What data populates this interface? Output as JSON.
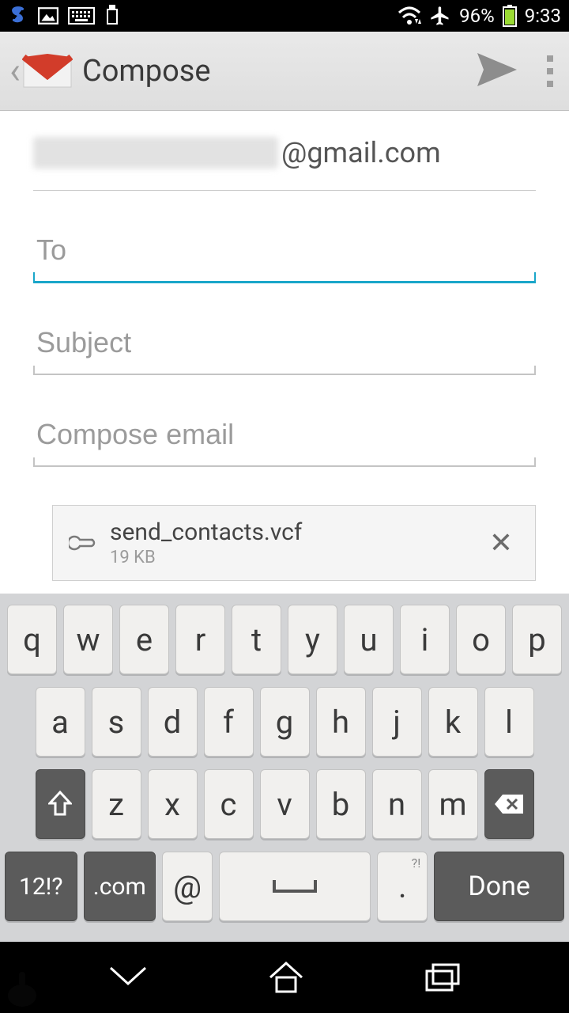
{
  "statusbar": {
    "battery_pct": "96%",
    "clock": "9:33"
  },
  "appbar": {
    "title": "Compose"
  },
  "compose": {
    "from_suffix": "@gmail.com",
    "to_placeholder": "To",
    "to_value": "",
    "subject_placeholder": "Subject",
    "subject_value": "",
    "body_placeholder": "Compose email",
    "body_value": ""
  },
  "attachment": {
    "name": "send_contacts.vcf",
    "size": "19 KB"
  },
  "keyboard": {
    "row1": [
      "q",
      "w",
      "e",
      "r",
      "t",
      "y",
      "u",
      "i",
      "o",
      "p"
    ],
    "row2": [
      "a",
      "s",
      "d",
      "f",
      "g",
      "h",
      "j",
      "k",
      "l"
    ],
    "row3": [
      "z",
      "x",
      "c",
      "v",
      "b",
      "n",
      "m"
    ],
    "sym": "12!?",
    "com": ".com",
    "at": "@",
    "period": ".",
    "period_hint": "?!",
    "done": "Done"
  }
}
